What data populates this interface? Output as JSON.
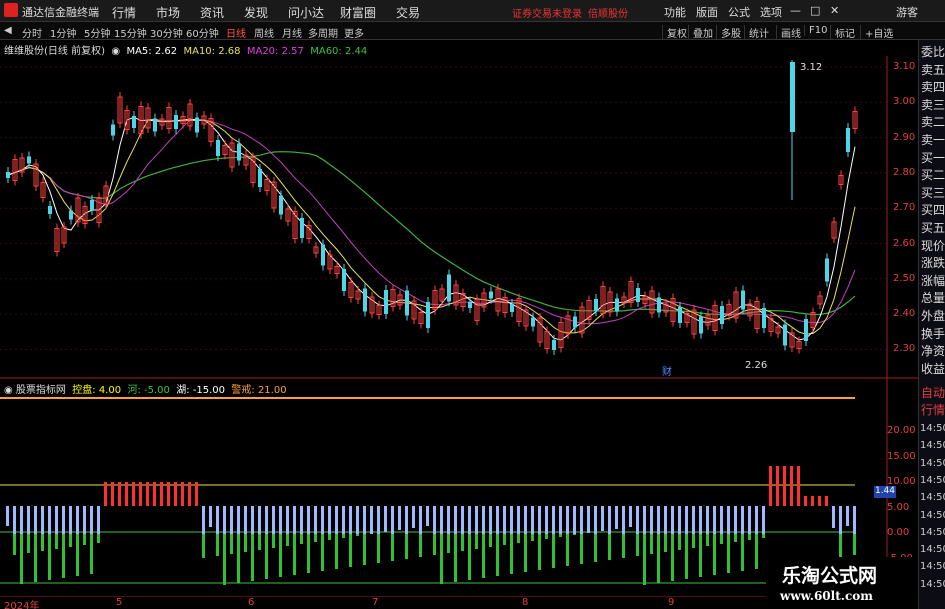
{
  "app": {
    "title": "通达信金融终端"
  },
  "menu": {
    "items": [
      "行情",
      "市场",
      "资讯",
      "发现",
      "问小达",
      "财富圈",
      "交易"
    ],
    "status_login": "证券交易未登录",
    "status_account": "倍顺股份",
    "right_items": [
      "功能",
      "版面",
      "公式",
      "选项"
    ],
    "guest": "游客"
  },
  "toolbar": {
    "periods": [
      "分时",
      "1分钟",
      "5分钟",
      "15分钟",
      "30分钟",
      "60分钟",
      "日线",
      "周线",
      "月线",
      "多周期",
      "更多"
    ],
    "active_period": "日线",
    "right_items": [
      "复权",
      "叠加",
      "多股",
      "统计",
      "画线",
      "F10",
      "标记",
      "+自选"
    ]
  },
  "chart": {
    "stock_label": "维维股份(日线 前复权)",
    "ma": [
      {
        "label": "MA5: 2.62",
        "color": "#ffffff"
      },
      {
        "label": "MA10: 2.68",
        "color": "#e8e060"
      },
      {
        "label": "MA20: 2.57",
        "color": "#e040e0"
      },
      {
        "label": "MA60: 2.44",
        "color": "#40c040"
      }
    ],
    "price_ticks": [
      "3.10",
      "3.00",
      "2.90",
      "2.80",
      "2.70",
      "2.60",
      "2.50",
      "2.40",
      "2.30"
    ],
    "high_label": "3.12",
    "low_label": "2.26",
    "marker_label": "财"
  },
  "indicator": {
    "name": "股票指标网",
    "items": [
      {
        "label": "控盘: 4.00",
        "color": "#ffff00"
      },
      {
        "label": "河: -5.00",
        "color": "#40c040"
      },
      {
        "label": "湖: -15.00",
        "color": "#ffffff"
      },
      {
        "label": "警戒: 21.00",
        "color": "#ffa030"
      }
    ],
    "ticks": [
      "20.00",
      "15.00",
      "10.00",
      "5.00",
      "0.00",
      "-5.00"
    ],
    "value_box": "1.44",
    "chart_data": {
      "type": "bar",
      "lines": {
        "warning": 21,
        "upper": 5,
        "river": -5,
        "lake": -15
      }
    }
  },
  "right_panel": {
    "items": [
      "委比",
      "卖五",
      "卖四",
      "卖三",
      "卖二",
      "卖一",
      "买一",
      "买二",
      "买三",
      "买四",
      "买五",
      "现价",
      "涨跌",
      "涨幅",
      "总量",
      "外盘",
      "换手",
      "净资",
      "收益"
    ],
    "lower_items": [
      "自动",
      "行情"
    ],
    "times": [
      "14:50",
      "14:50",
      "14:50",
      "14:50",
      "14:50",
      "14:50",
      "14:50",
      "14:50",
      "14:50",
      "14:50"
    ]
  },
  "dates": [
    "2024年",
    "5",
    "6",
    "7",
    "8",
    "9"
  ],
  "watermark": {
    "title": "乐淘公式网",
    "url": "www.60lt.com"
  }
}
